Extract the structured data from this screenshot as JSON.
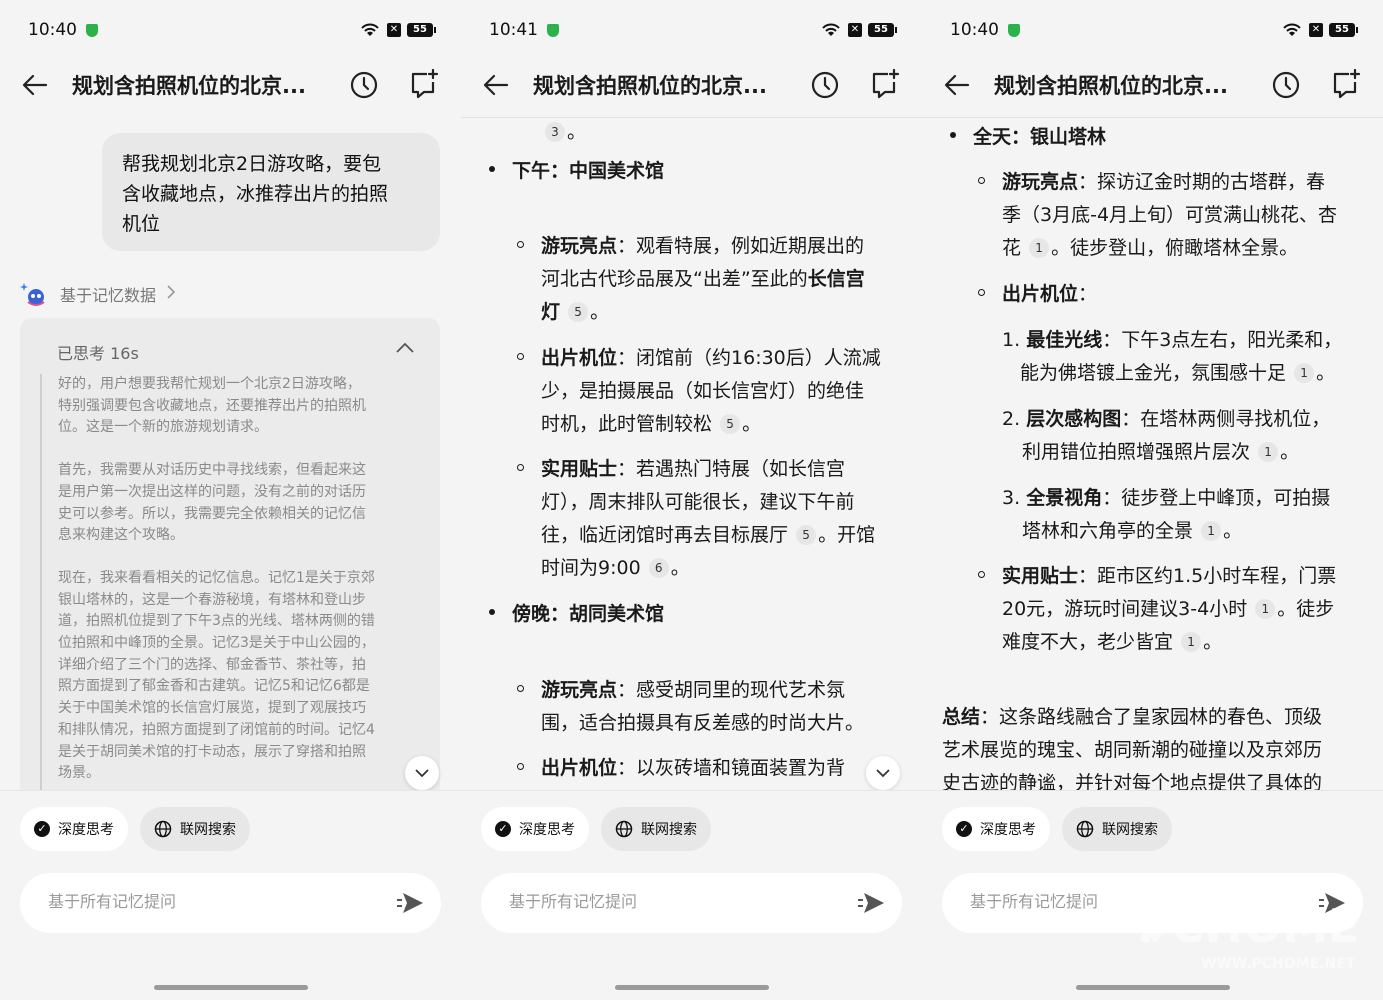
{
  "status": [
    {
      "time": "10:40",
      "battery": "55"
    },
    {
      "time": "10:41",
      "battery": "55"
    },
    {
      "time": "10:40",
      "battery": "55"
    }
  ],
  "header": {
    "title": "规划含拍照机位的北京..."
  },
  "bottom": {
    "chip_deep": "深度思考",
    "chip_web": "联网搜索",
    "input_placeholder": "基于所有记忆提问"
  },
  "panel1": {
    "user_msg": [
      "帮我规划北京2日游攻略，要包",
      "含收藏地点，冰推荐出片的拍照",
      "机位"
    ],
    "memory_label": "基于记忆数据",
    "thought_label": "已思考 16s",
    "thinking_lines": [
      [
        "好的，用户想要我帮忙规划一个北京2日游攻略，",
        "特别强调要包含收藏地点，还要推荐出片的拍照机",
        "位。这是一个新的旅游规划请求。"
      ],
      [
        "首先，我需要从对话历史中寻找线索，但看起来这",
        "是用户第一次提出这样的问题，没有之前的对话历",
        "史可以参考。所以，我需要完全依赖相关的记忆信",
        "息来构建这个攻略。"
      ],
      [
        "现在，我来看看相关的记忆信息。记忆1是关于京郊",
        "银山塔林的，这是一个春游秘境，有塔林和登山步",
        "道，拍照机位提到了下午3点的光线、塔林两侧的错",
        "位拍照和中峰顶的全景。记忆3是关于中山公园的，",
        "详细介绍了三个门的选择、郁金香节、茶社等，拍",
        "照方面提到了郁金香和古建筑。记忆5和记忆6都是",
        "关于中国美术馆的长信宫灯展览，提到了观展技巧",
        "和排队情况，拍照方面提到了闭馆前的时间。记忆4",
        "是关于胡同美术馆的打卡动态，展示了穿搭和拍照",
        "场景。"
      ]
    ]
  },
  "panel2": {
    "top_cite": "3",
    "top_tail": "。",
    "sec1_title": "下午：中国美术馆",
    "s1a_label": "游玩亮点",
    "s1a_lines": [
      "：观看特展，例如近期展出的",
      "河北古代珍品展及“出差”至此的",
      "灯"
    ],
    "s1a_bold_tail": "长信宫",
    "s1a_cite": "5",
    "s1b_label": "出片机位",
    "s1b_lines": [
      "：闭馆前（约16:30后）人流减",
      "少，是拍摄展品（如长信宫灯）的绝佳",
      "时机，此时管制较松"
    ],
    "s1b_cite": "5",
    "s1c_label": "实用贴士",
    "s1c_lines": [
      "：若遇热门特展（如长信宫",
      "灯），周末排队可能很长，建议下午前",
      "往，临近闭馆时再去目标展厅",
      "。开馆",
      "时间为9:00"
    ],
    "s1c_cite1": "5",
    "s1c_cite2": "6",
    "sec2_title": "傍晚：胡同美术馆",
    "s2a_label": "游玩亮点",
    "s2a_lines": [
      "：感受胡同里的现代艺术氛",
      "围，适合拍摄具有反差感的时尚大片。"
    ],
    "s2b_label": "出片机位",
    "s2b_line": "：以灰砖墙和镜面装置为背"
  },
  "panel3": {
    "sec_title": "全天：银山塔林",
    "h_label": "游玩亮点",
    "h_lines": [
      "：探访辽金时期的古塔群，春",
      "季（3月底-4月上旬）可赏满山桃花、杏",
      "花",
      "。徒步登山，俯瞰塔林全景。"
    ],
    "h_cite": "1",
    "p_label": "出片机位",
    "p_colon": "：",
    "items": [
      {
        "num": "1.",
        "label": "最佳光线",
        "l1": "：下午3点左右，阳光柔和，",
        "l2": "能为佛塔镀上金光，氛围感十足",
        "cite": "1"
      },
      {
        "num": "2.",
        "label": "层次感构图",
        "l1": "：在塔林两侧寻找机位，",
        "l2": "利用错位拍照增强照片层次",
        "cite": "1"
      },
      {
        "num": "3.",
        "label": "全景视角",
        "l1": "：徒步登上中峰顶，可拍摄",
        "l2": "塔林和六角亭的全景",
        "cite": "1"
      }
    ],
    "t_label": "实用贴士",
    "t_lines": [
      "：距市区约1.5小时车程，门票",
      "20元，游玩时间建议3-4小时",
      "。徒步",
      "难度不大，老少皆宜"
    ],
    "t_cite1": "1",
    "t_cite2": "1",
    "sum_label": "总结",
    "sum_lines": [
      "：这条路线融合了皇家园林的春色、顶级",
      "艺术展览的瑰宝、胡同新潮的碰撞以及京郊历",
      "史古迹的静谧，并针对每个地点提供了具体的"
    ]
  },
  "watermark": {
    "brand": "PCHOME",
    "url": "WWW.PCHOME.NET"
  },
  "colors": {
    "bg": "#f4f4f4",
    "bubble": "#e8e8e8",
    "shield": "#2cb24a",
    "cite_bg": "#e6e6e6"
  }
}
